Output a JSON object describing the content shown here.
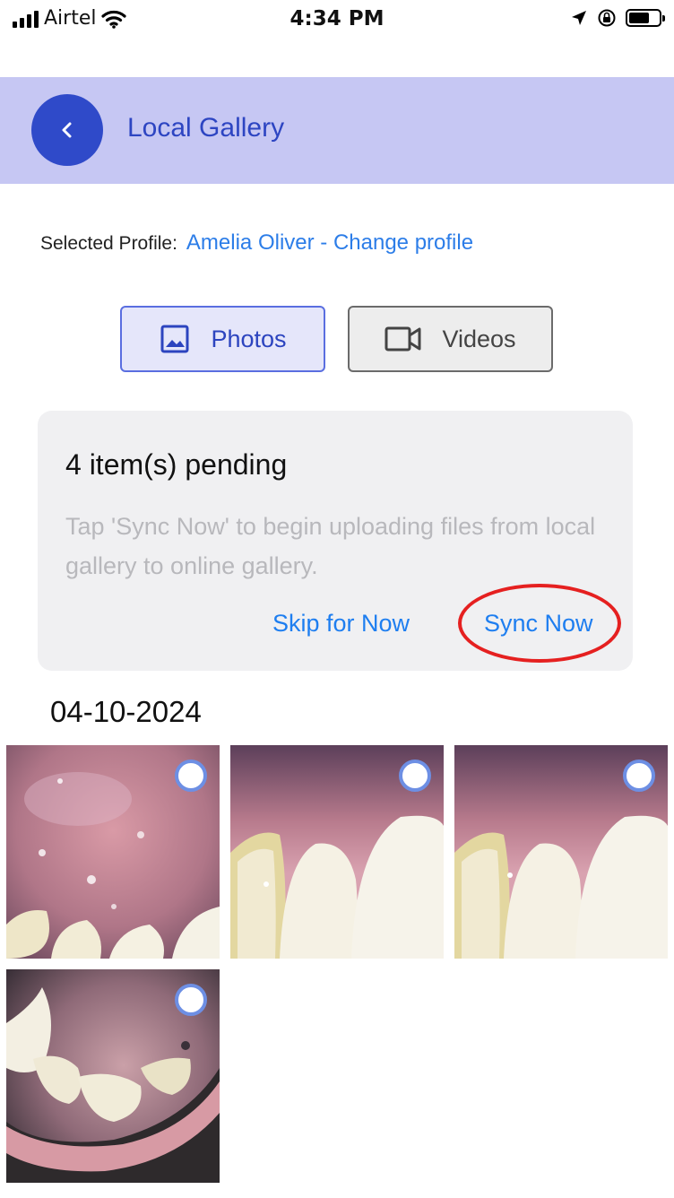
{
  "status_bar": {
    "carrier": "Airtel",
    "time": "4:34 PM"
  },
  "header": {
    "title": "Local Gallery"
  },
  "profile": {
    "label": "Selected Profile:",
    "value": "Amelia Oliver - Change profile"
  },
  "tabs": {
    "photos": "Photos",
    "videos": "Videos",
    "selected": "Photos"
  },
  "sync_card": {
    "title": "4 item(s) pending",
    "description": "Tap 'Sync Now' to begin uploading files from local gallery to online gallery.",
    "skip_label": "Skip for Now",
    "sync_label": "Sync Now"
  },
  "gallery": {
    "date": "04-10-2024",
    "photo_count": 4
  },
  "colors": {
    "header_bg": "#c6c7f3",
    "accent_blue": "#2f4ac9",
    "link_blue": "#1e7ef0",
    "highlight_red": "#e52020"
  }
}
